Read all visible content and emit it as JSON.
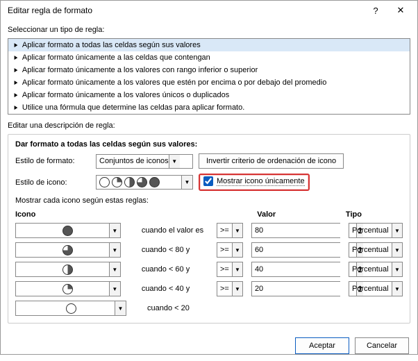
{
  "title": "Editar regla de formato",
  "section_select": "Seleccionar un tipo de regla:",
  "rule_types": [
    "Aplicar formato a todas las celdas según sus valores",
    "Aplicar formato únicamente a las celdas que contengan",
    "Aplicar formato únicamente a los valores con rango inferior o superior",
    "Aplicar formato únicamente a los valores que estén por encima o por debajo del promedio",
    "Aplicar formato únicamente a los valores únicos o duplicados",
    "Utilice una fórmula que determine las celdas para aplicar formato."
  ],
  "section_edit": "Editar una descripción de regla:",
  "format_header": "Dar formato a todas las celdas según sus valores:",
  "labels": {
    "format_style": "Estilo de formato:",
    "icon_style": "Estilo de icono:",
    "show_each": "Mostrar cada icono según estas reglas:"
  },
  "format_style_value": "Conjuntos de iconos",
  "invert_btn": "Invertir criterio de ordenación de icono",
  "show_icon_only": "Mostrar icono únicamente",
  "headers": {
    "icon": "Icono",
    "value": "Valor",
    "tipo": "Tipo"
  },
  "rows": [
    {
      "cond": "cuando el valor es",
      "op": ">=",
      "val": "80",
      "tipo": "Porcentual",
      "fill": "full"
    },
    {
      "cond": "cuando < 80 y",
      "op": ">=",
      "val": "60",
      "tipo": "Porcentual",
      "fill": "q3"
    },
    {
      "cond": "cuando < 60 y",
      "op": ">=",
      "val": "40",
      "tipo": "Porcentual",
      "fill": "q2"
    },
    {
      "cond": "cuando < 40 y",
      "op": ">=",
      "val": "20",
      "tipo": "Porcentual",
      "fill": "q1"
    },
    {
      "cond": "cuando < 20",
      "op": "",
      "val": "",
      "tipo": "",
      "fill": "empty"
    }
  ],
  "buttons": {
    "ok": "Aceptar",
    "cancel": "Cancelar"
  }
}
